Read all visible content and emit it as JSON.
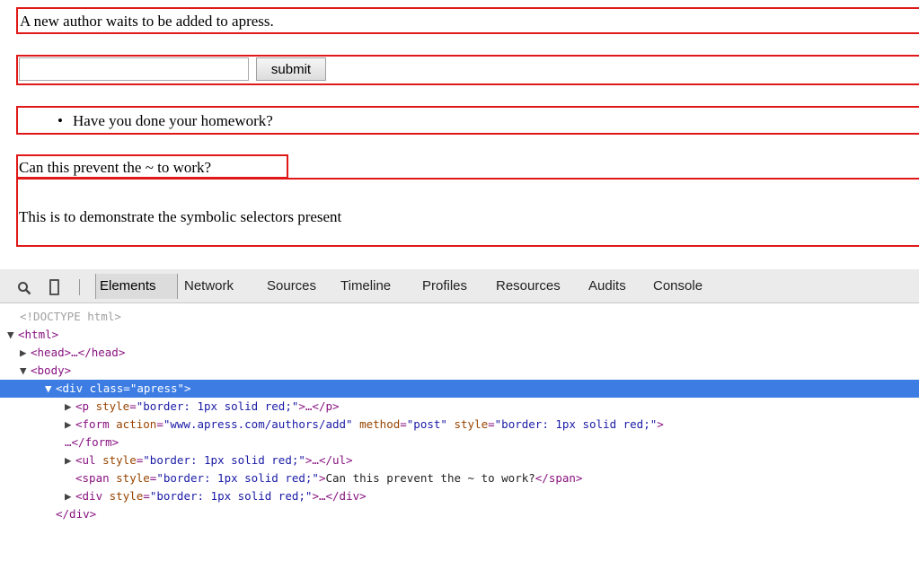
{
  "page": {
    "paragraph": "A new author waits to be added to apress.",
    "form": {
      "input_value": "",
      "submit_label": "submit"
    },
    "list": {
      "bullet": "•",
      "item": "Have you done your homework?"
    },
    "span": "Can this prevent the ~ to work?",
    "div": "This is to demonstrate the symbolic selectors present"
  },
  "devtools": {
    "tabs": [
      "Elements",
      "Network",
      "Sources",
      "Timeline",
      "Profiles",
      "Resources",
      "Audits",
      "Console"
    ],
    "active_tab": "Elements",
    "tree": {
      "l1": "<!DOCTYPE html>",
      "l2": "<html>",
      "l3": "<head>…</head>",
      "l4": "<body>",
      "l5": {
        "open": "<div ",
        "attr": "class",
        "eq": "=",
        "val": "\"apress\"",
        "close": ">"
      },
      "l6": {
        "open": "<p ",
        "attr": "style",
        "eq": "=",
        "val": "\"border: 1px solid red;\"",
        "close": ">…</p>"
      },
      "l7": {
        "open": "<form ",
        "a1": "action",
        "v1": "\"www.apress.com/authors/add\"",
        "a2": "method",
        "v2": "\"post\"",
        "a3": "style",
        "v3": "\"border: 1px solid red;\"",
        "close": ">"
      },
      "l8": "…</form>",
      "l9": {
        "open": "<ul ",
        "attr": "style",
        "eq": "=",
        "val": "\"border: 1px solid red;\"",
        "close": ">…</ul>"
      },
      "l10": {
        "open": "<span ",
        "attr": "style",
        "eq": "=",
        "val": "\"border: 1px solid red;\"",
        "gt": ">",
        "text": "Can this prevent the ~ to work?",
        "close": "</span>"
      },
      "l11": {
        "open": "<div ",
        "attr": "style",
        "eq": "=",
        "val": "\"border: 1px solid red;\"",
        "close": ">…</div>"
      },
      "l12": "</div>"
    },
    "arrows": {
      "expanded": "▼",
      "collapsed": "▶"
    }
  }
}
